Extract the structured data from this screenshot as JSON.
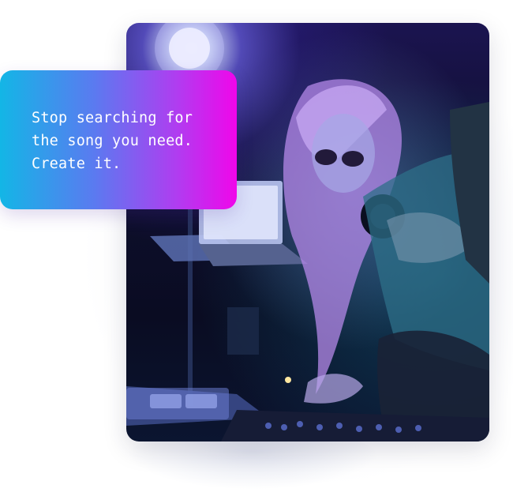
{
  "callout": {
    "lines": [
      "Stop searching for",
      "the song you need.",
      "Create it."
    ]
  },
  "photo": {
    "subject": "dj-performer",
    "icon": "dj-photo"
  },
  "colors": {
    "gradient_start": "#13b6e6",
    "gradient_mid": "#5b7af0",
    "gradient_end": "#f006ea",
    "photo_background": "#0f0f2e"
  }
}
